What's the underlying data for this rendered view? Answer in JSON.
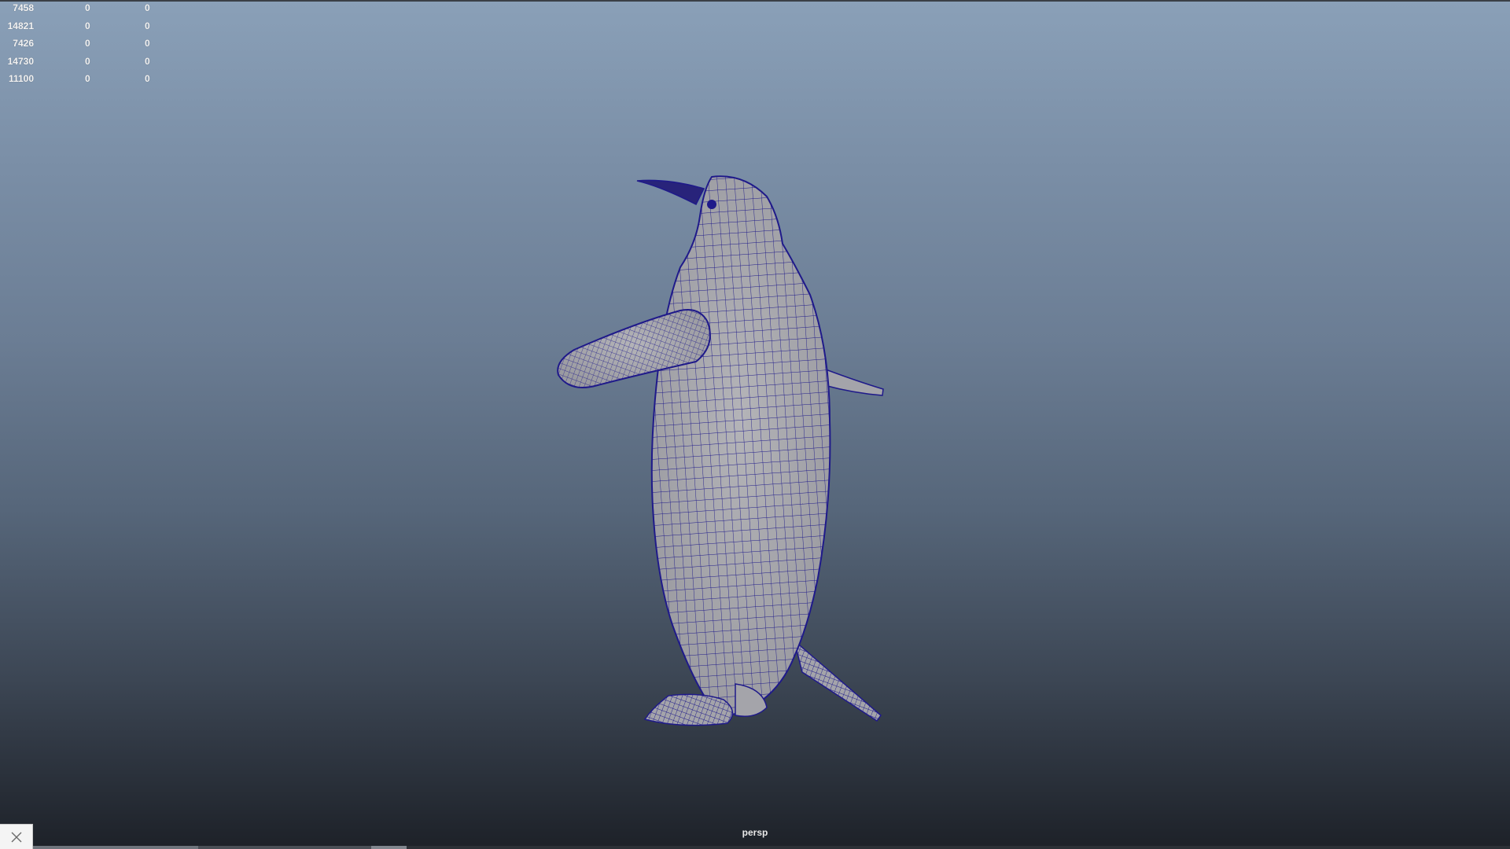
{
  "hud": {
    "rows": [
      {
        "a": "7458",
        "b": "0",
        "c": "0"
      },
      {
        "a": "14821",
        "b": "0",
        "c": "0"
      },
      {
        "a": "7426",
        "b": "0",
        "c": "0"
      },
      {
        "a": "14730",
        "b": "0",
        "c": "0"
      },
      {
        "a": "11100",
        "b": "0",
        "c": "0"
      }
    ]
  },
  "viewport": {
    "camera_label": "persp",
    "wireframe_color": "#1f1a8a",
    "mesh_color": "#a9a9ad",
    "background_top": "#8aa0b8",
    "background_bottom": "#1d2128"
  },
  "icons": {
    "close": "close-icon"
  }
}
